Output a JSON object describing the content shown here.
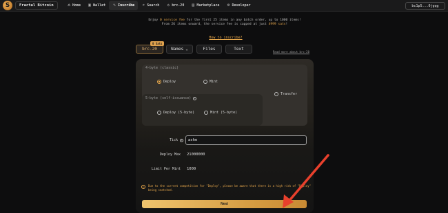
{
  "nav": {
    "brand": "Fractal Bitcoin",
    "items": [
      {
        "label": "Home",
        "icon": "home-icon",
        "glyph": "⌂",
        "active": false
      },
      {
        "label": "Wallet",
        "icon": "wallet-icon",
        "glyph": "▣",
        "active": false
      },
      {
        "label": "Inscribe",
        "icon": "inscribe-icon",
        "glyph": "✎",
        "active": true
      },
      {
        "label": "Search",
        "icon": "search-icon",
        "glyph": "⌕",
        "active": false
      },
      {
        "label": "brc-20",
        "icon": "code-icon",
        "glyph": "◇",
        "active": false
      },
      {
        "label": "Marketplace",
        "icon": "market-icon",
        "glyph": "▤",
        "active": false
      },
      {
        "label": "Developer",
        "icon": "developer-icon",
        "glyph": "⚙",
        "active": false
      }
    ],
    "wallet": "bc1p5...0jgqg"
  },
  "promo": {
    "line1_pre": "Enjoy ",
    "line1_hl": "0 service fee",
    "line1_post": " for the first 25 items in any batch order, up to 1000 items!",
    "line2_pre": "From 26 items onward, the service fee is capped at just ",
    "line2_hl": "4999 sats",
    "line2_post": "!",
    "link": "How to inscribe?"
  },
  "tabs": {
    "brc": "brc-20",
    "names": "Names",
    "files": "Files",
    "text": "Text",
    "hot_badge": "0 Sats",
    "read_more": "Read more about brc-20"
  },
  "options": {
    "four_byte_label": "4-byte (classic)",
    "deploy": "Deploy",
    "mint": "Mint",
    "transfer": "Transfer",
    "five_byte_label": "5-byte (self-issuance)",
    "deploy5": "Deploy (5-byte)",
    "mint5": "Mint (5-byte)"
  },
  "form": {
    "tick_label": "Tick",
    "tick_value": "ashe",
    "deploy_max_label": "Deploy Max",
    "deploy_max_value": "21000000",
    "limit_label": "Limit Per Mint",
    "limit_value": "1000"
  },
  "warning": {
    "text": "Due to the current competition for \"Deploy\", please be aware that there is a high risk of \"Deploy\" being snatched."
  },
  "next": "Next",
  "colors": {
    "accent": "#e7a84c",
    "arrow": "#e8402c"
  }
}
